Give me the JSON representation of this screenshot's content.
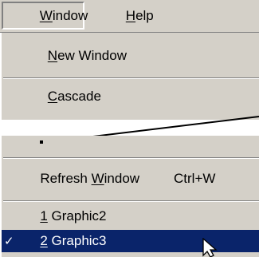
{
  "menubar": {
    "window": {
      "mnemonic": "W",
      "rest": "indow"
    },
    "help": {
      "mnemonic": "H",
      "rest": "elp"
    }
  },
  "window_menu_top": {
    "new_window": {
      "mnemonic": "N",
      "rest": "ew Window"
    },
    "cascade": {
      "mnemonic": "C",
      "rest": "ascade"
    }
  },
  "window_menu_bottom": {
    "refresh": {
      "prefix": "Refresh ",
      "mnemonic": "W",
      "rest": "indow",
      "shortcut": "Ctrl+W"
    },
    "graphic2": {
      "number": "1",
      "name": " Graphic2"
    },
    "graphic3": {
      "check": "✓",
      "number": "2",
      "name": " Graphic3",
      "checked": true,
      "highlighted": true
    }
  },
  "colors": {
    "menu_face": "#d4d0c8",
    "highlight": "#0a246a",
    "highlight_text": "#ffffff"
  },
  "icons": [
    "checkmark-icon",
    "mouse-cursor-icon"
  ]
}
